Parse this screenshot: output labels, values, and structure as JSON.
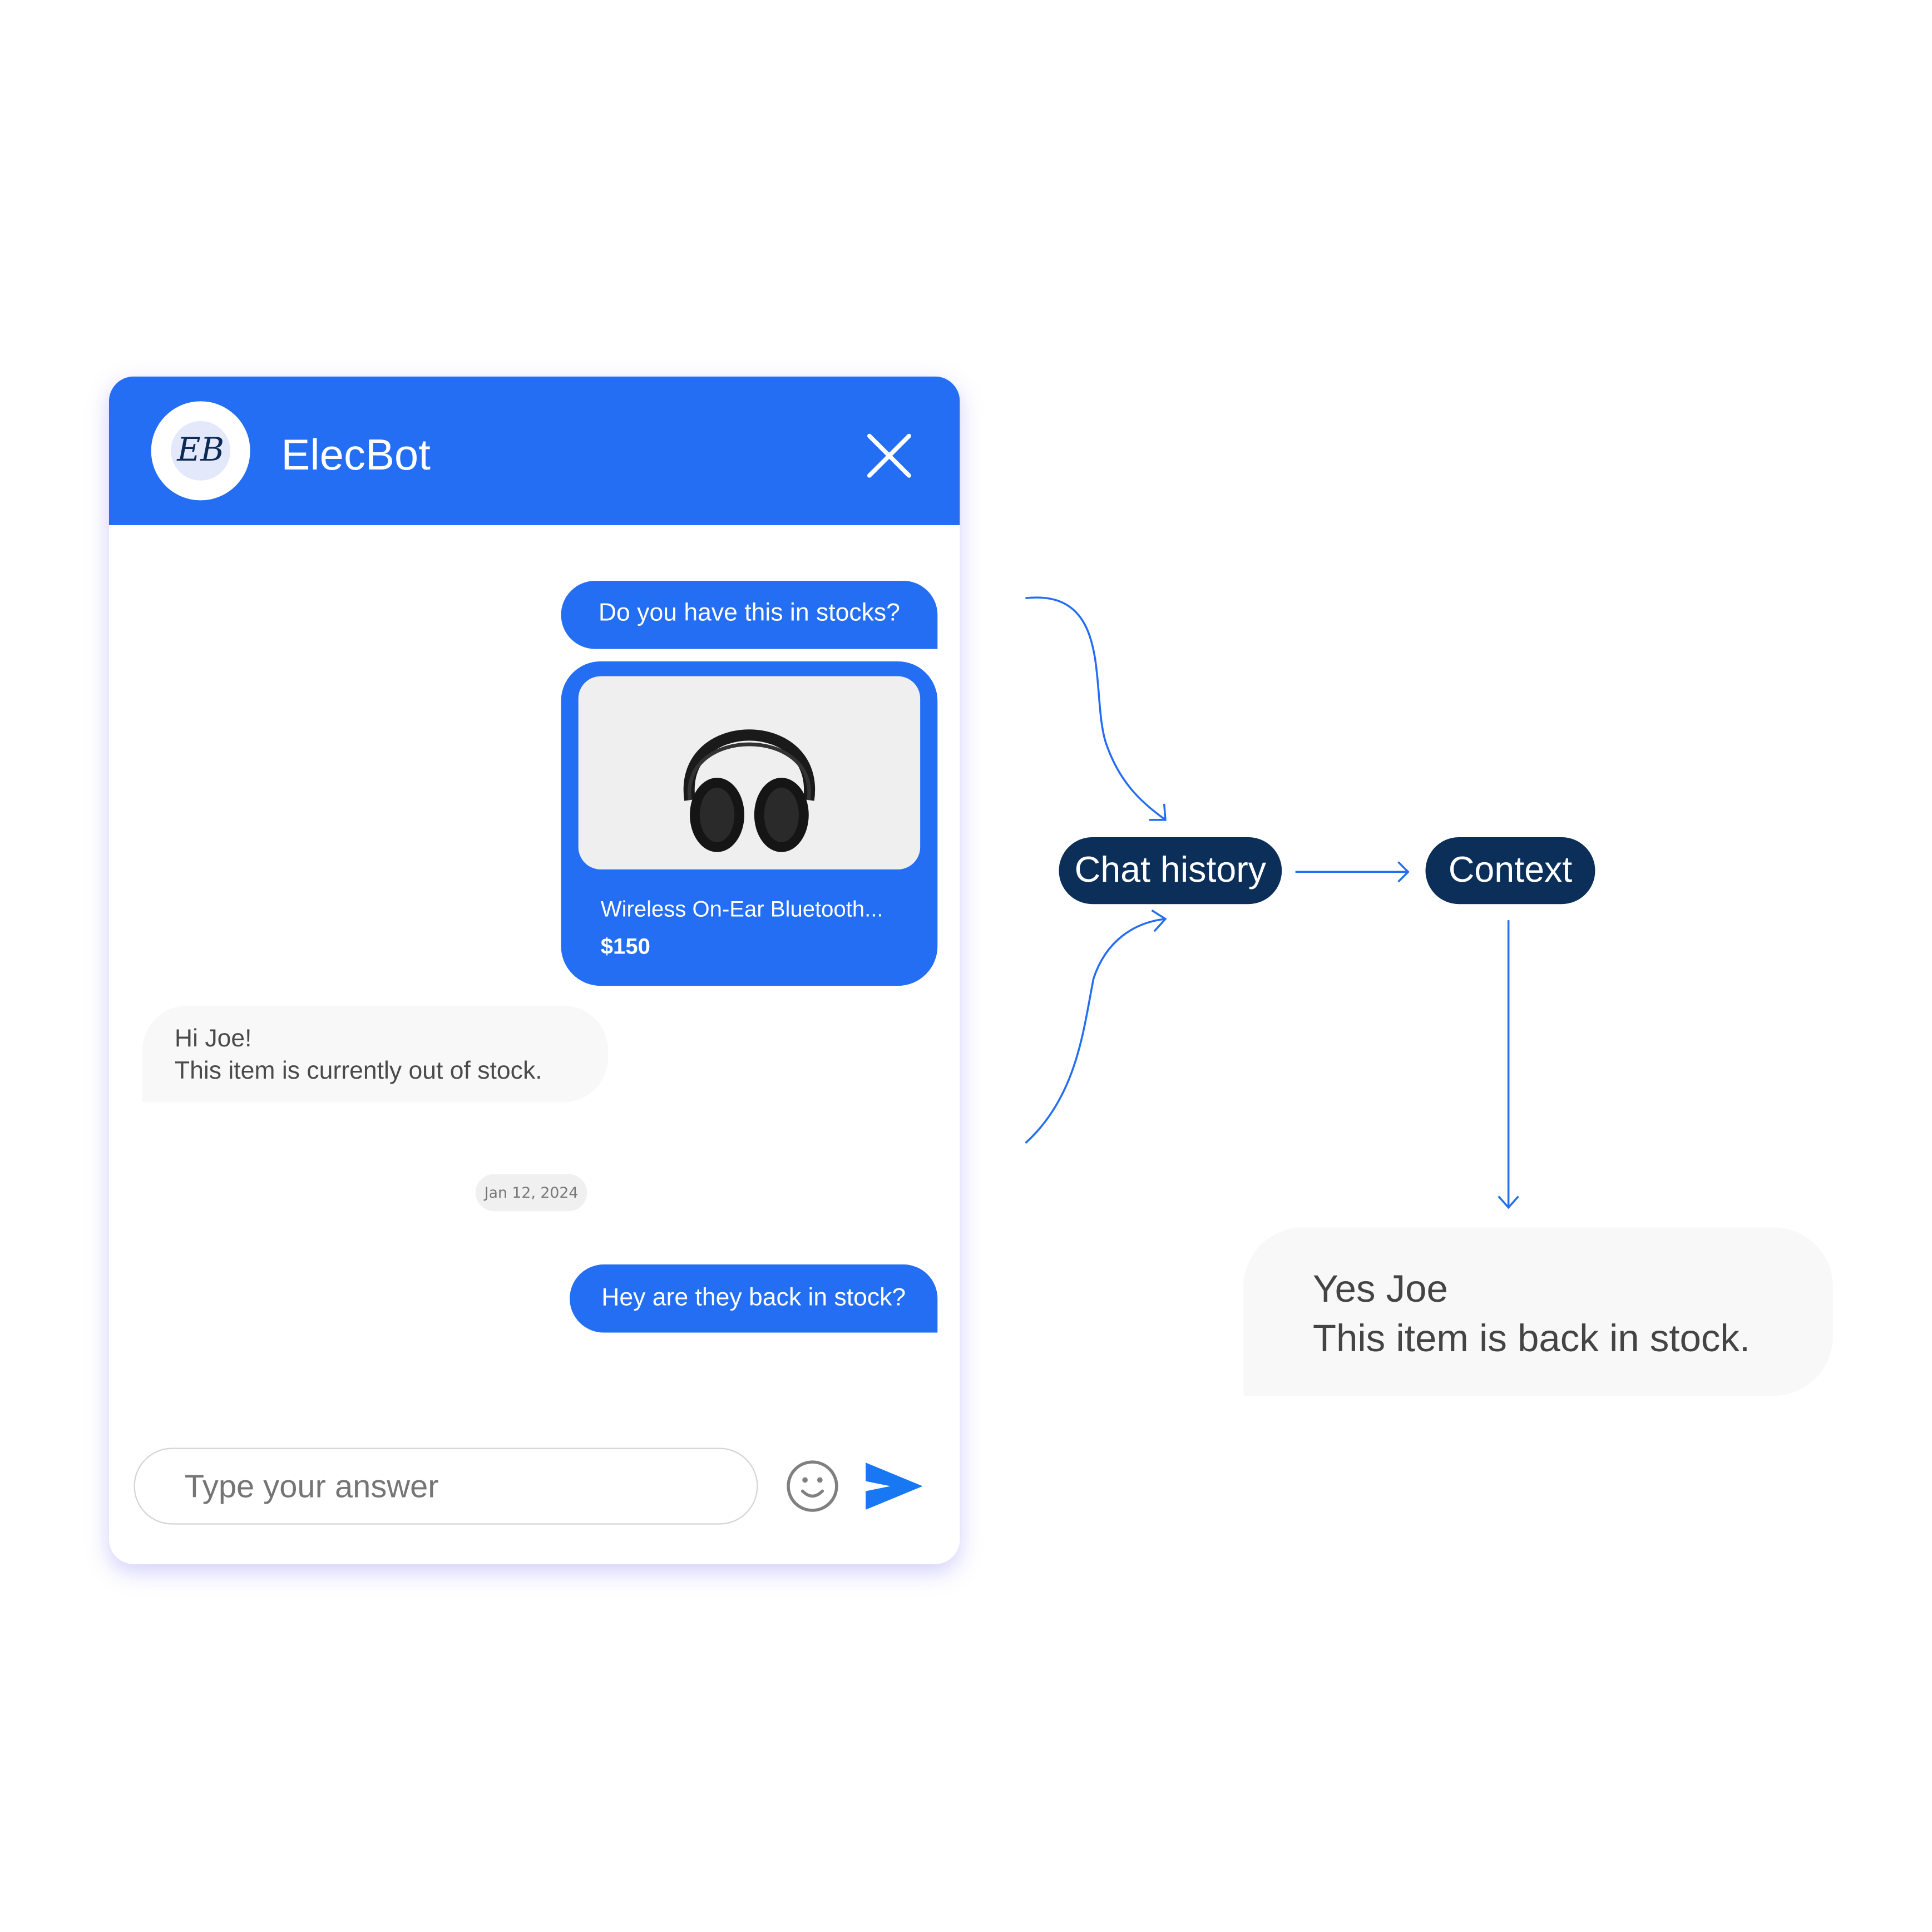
{
  "chat_widget": {
    "avatar_initials": "EB",
    "title": "ElecBot",
    "close_icon": "close-icon",
    "messages": [
      {
        "sender": "user",
        "text": "Do you have this in stocks?"
      },
      {
        "sender": "user",
        "type": "product",
        "product_name": "Wireless On-Ear Bluetooth...",
        "price": "$150",
        "image": "headphones"
      },
      {
        "sender": "bot",
        "lines": [
          "Hi Joe!",
          "This item is currently out of stock."
        ]
      },
      {
        "sender": "user",
        "text": "Hey are they back in stock?"
      }
    ],
    "date_separator": "Jan 12, 2024",
    "input": {
      "placeholder": "Type your answer",
      "value": ""
    },
    "emoji_icon": "smiley-icon",
    "send_icon": "send-icon"
  },
  "diagram": {
    "nodes": [
      {
        "id": "chat-history",
        "label": "Chat history"
      },
      {
        "id": "context",
        "label": "Context"
      }
    ],
    "edges": [
      {
        "from": "user-question-1",
        "to": "chat-history"
      },
      {
        "from": "user-question-2",
        "to": "chat-history"
      },
      {
        "from": "chat-history",
        "to": "context"
      },
      {
        "from": "context",
        "to": "answer"
      }
    ],
    "answer": {
      "lines": [
        "Yes Joe",
        "This item is back in stock."
      ]
    }
  },
  "colors": {
    "brand_blue": "#246ef3",
    "node_navy": "#0b2f58",
    "send_blue": "#1877f2",
    "bubble_gray": "#f8f8f8"
  }
}
